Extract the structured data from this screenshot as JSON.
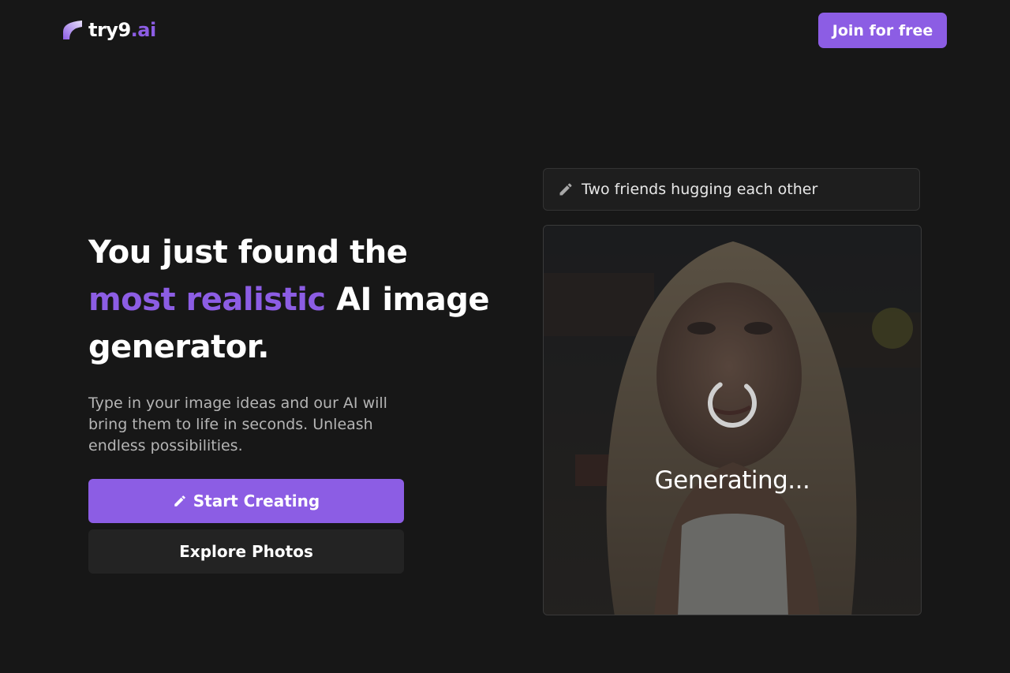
{
  "brand": {
    "name_main": "try9",
    "name_accent": ".ai",
    "accent_color": "#8c5de4"
  },
  "header": {
    "join_label": "Join for free"
  },
  "hero": {
    "headline_part1": "You just found the ",
    "headline_accent": "most realistic",
    "headline_part2": " AI image generator.",
    "description": "Type in your image ideas and our AI will bring them to life in seconds. Unleash endless possibilities.",
    "start_label": "Start Creating",
    "explore_label": "Explore Photos"
  },
  "preview": {
    "prompt_text": "Two friends hugging each other",
    "status_text": "Generating..."
  },
  "icons": {
    "prompt": "pencil-icon",
    "start": "pencil-icon",
    "status": "spinner-icon"
  }
}
